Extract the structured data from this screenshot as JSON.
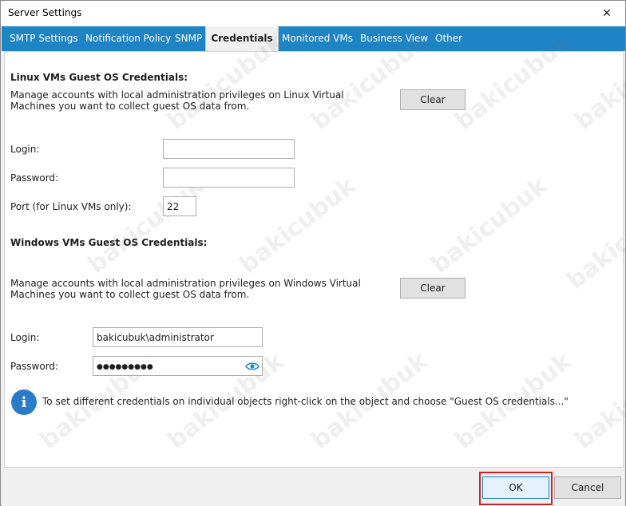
{
  "window": {
    "title": "Server Settings",
    "close_glyph": "✕"
  },
  "tabs": [
    {
      "label": "SMTP Settings",
      "active": false
    },
    {
      "label": "Notification Policy",
      "active": false
    },
    {
      "label": "SNMP",
      "active": false
    },
    {
      "label": "Credentials",
      "active": true
    },
    {
      "label": "Monitored VMs",
      "active": false
    },
    {
      "label": "Business View",
      "active": false
    },
    {
      "label": "Other",
      "active": false
    }
  ],
  "linux": {
    "heading": "Linux VMs Guest OS Credentials:",
    "description": "Manage accounts with local administration privileges on Linux Virtual Machines you want to collect guest OS data from.",
    "clear_label": "Clear",
    "login_label": "Login:",
    "login_value": "",
    "password_label": "Password:",
    "password_value": "",
    "port_label": "Port (for Linux VMs only):",
    "port_value": "22"
  },
  "windows": {
    "heading": "Windows VMs Guest OS Credentials:",
    "description": "Manage accounts with local administration privileges on Windows Virtual Machines you want to collect guest OS data from.",
    "clear_label": "Clear",
    "login_label": "Login:",
    "login_value": "bakicubuk\\administrator",
    "password_label": "Password:",
    "password_value": "●●●●●●●●●"
  },
  "info": {
    "icon_glyph": "i",
    "text": "To set different credentials on individual objects right-click on the object and choose \"Guest OS credentials...\""
  },
  "footer": {
    "ok_label": "OK",
    "cancel_label": "Cancel"
  },
  "watermark": "bakicubuk",
  "colors": {
    "tab_strip": "#1d84c6",
    "info_icon": "#2a7cc7",
    "ok_highlight": "#d32022"
  }
}
